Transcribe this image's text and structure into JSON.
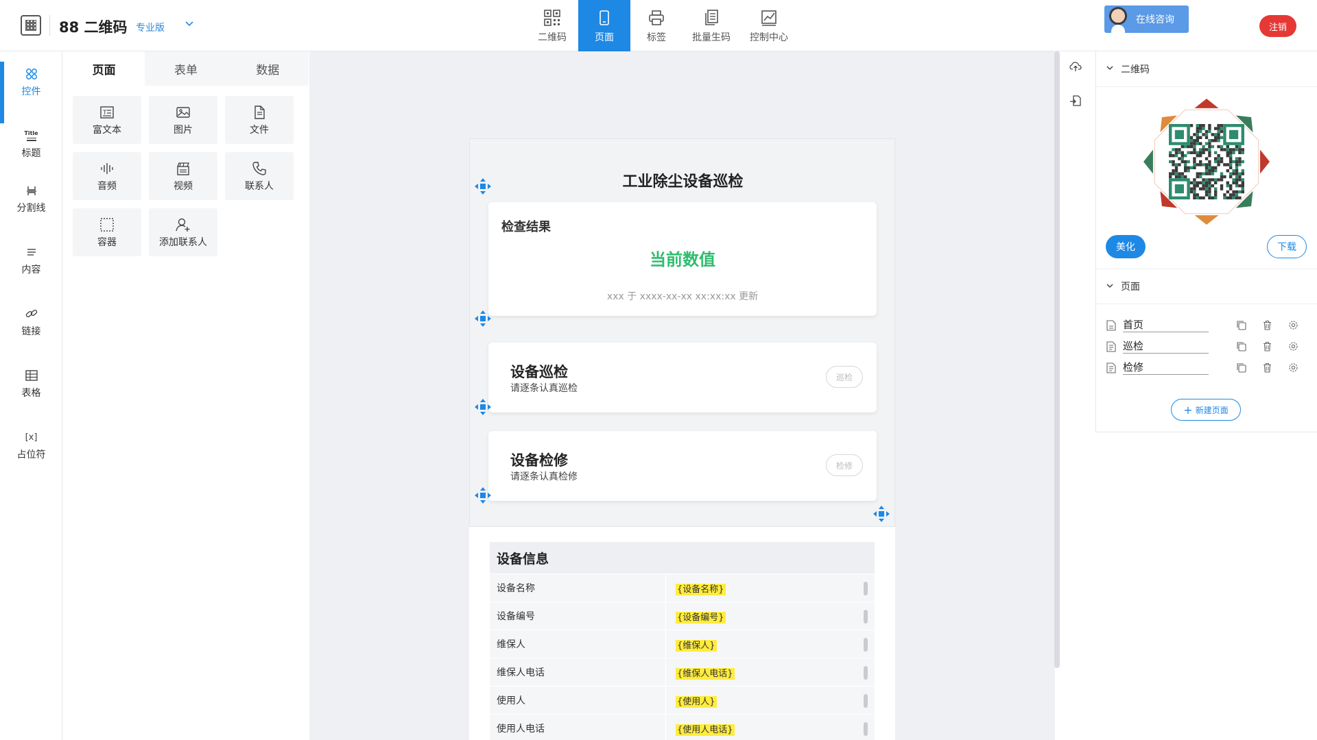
{
  "header": {
    "brand": "88 二维码",
    "edition": "专业版",
    "nav": [
      {
        "label": "二维码",
        "icon": "qrcode-icon"
      },
      {
        "label": "页面",
        "icon": "phone-icon",
        "active": true
      },
      {
        "label": "标签",
        "icon": "printer-icon"
      },
      {
        "label": "批量生码",
        "icon": "batch-icon"
      },
      {
        "label": "控制中心",
        "icon": "chart-icon"
      }
    ],
    "consult_label": "在线咨询",
    "logout_label": "注销"
  },
  "rail": {
    "items": [
      {
        "label": "控件",
        "icon": "grid-icon",
        "active": true
      },
      {
        "label": "标题",
        "icon": "title-icon"
      },
      {
        "label": "分割线",
        "icon": "divider-icon"
      },
      {
        "label": "内容",
        "icon": "lines-icon"
      },
      {
        "label": "链接",
        "icon": "link-icon"
      },
      {
        "label": "表格",
        "icon": "table-icon"
      },
      {
        "label": "占位符",
        "icon": "placeholder-icon"
      }
    ],
    "title_icon_text": "Title",
    "placeholder_icon_text": "[x]"
  },
  "widgets": {
    "tabs": [
      "页面",
      "表单",
      "数据"
    ],
    "items": [
      {
        "label": "富文本",
        "icon": "richtext-icon"
      },
      {
        "label": "图片",
        "icon": "image-icon"
      },
      {
        "label": "文件",
        "icon": "file-icon"
      },
      {
        "label": "音频",
        "icon": "audio-icon"
      },
      {
        "label": "视频",
        "icon": "video-icon"
      },
      {
        "label": "联系人",
        "icon": "phone-call-icon"
      },
      {
        "label": "容器",
        "icon": "container-icon"
      },
      {
        "label": "添加联系人",
        "icon": "add-user-icon"
      }
    ]
  },
  "page": {
    "title": "工业除尘设备巡检",
    "result": {
      "title": "检查结果",
      "value": "当前数值",
      "updated": "xxx 于 xxxx-xx-xx xx:xx:xx 更新"
    },
    "tasks": [
      {
        "title": "设备巡检",
        "subtitle": "请逐条认真巡检",
        "button": "巡检"
      },
      {
        "title": "设备检修",
        "subtitle": "请逐条认真检修",
        "button": "检修"
      }
    ],
    "info": {
      "title": "设备信息",
      "rows": [
        {
          "key": "设备名称",
          "value": "{设备名称}"
        },
        {
          "key": "设备编号",
          "value": "{设备编号}"
        },
        {
          "key": "维保人",
          "value": "{维保人}"
        },
        {
          "key": "维保人电话",
          "value": "{维保人电话}"
        },
        {
          "key": "使用人",
          "value": "{使用人}"
        },
        {
          "key": "使用人电话",
          "value": "{使用人电话}"
        }
      ]
    }
  },
  "right_panel": {
    "qr_section": "二维码",
    "beautify": "美化",
    "download": "下载",
    "pages_section": "页面",
    "pages": [
      "首页",
      "巡检",
      "检修"
    ],
    "new_page": "新建页面"
  },
  "colors": {
    "accent": "#1e88e5",
    "value_green": "#2ebd6e",
    "logout_red": "#e53935",
    "placeholder_yellow": "#ffec3d"
  }
}
